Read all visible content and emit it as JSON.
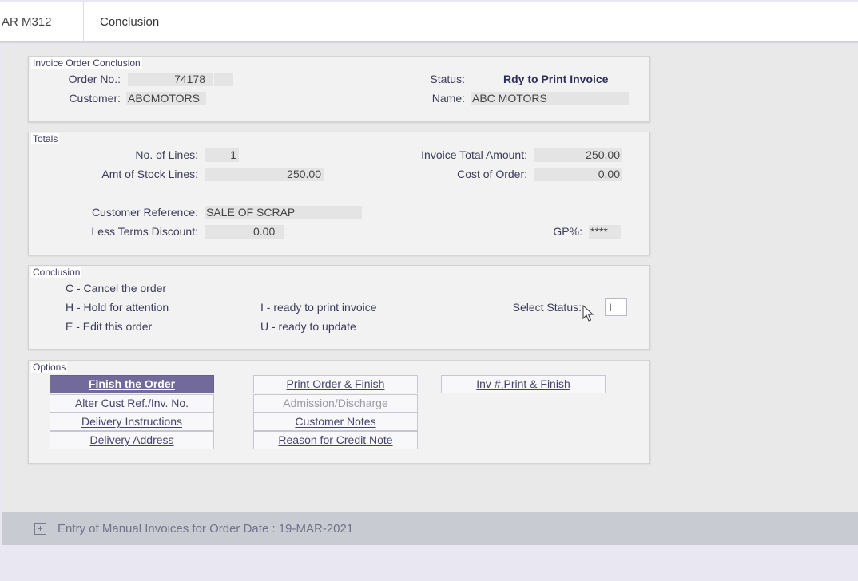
{
  "header": {
    "code": "AR M312",
    "title": "Conclusion"
  },
  "invoice_panel": {
    "legend": "Invoice Order Conclusion",
    "order_no_label": "Order No.:",
    "order_no": "74178",
    "order_suffix": "",
    "customer_label": "Customer:",
    "customer": "ABCMOTORS",
    "status_label": "Status:",
    "status": "Rdy to Print Invoice",
    "name_label": "Name:",
    "name": "ABC MOTORS"
  },
  "totals_panel": {
    "legend": "Totals",
    "lines_label": "No. of Lines:",
    "lines": "1",
    "stock_label": "Amt of Stock Lines:",
    "stock": "250.00",
    "invoice_total_label": "Invoice Total Amount:",
    "invoice_total": "250.00",
    "cost_label": "Cost of Order:",
    "cost": "0.00",
    "cust_ref_label": "Customer Reference:",
    "cust_ref": "SALE OF SCRAP",
    "terms_label": "Less Terms Discount:",
    "terms": "0.00",
    "gp_label": "GP%:",
    "gp": "****"
  },
  "conclusion_panel": {
    "legend": "Conclusion",
    "opt_c": "C  - Cancel the order",
    "opt_h": "H  - Hold for attention",
    "opt_e": "E  - Edit this order",
    "opt_i": "I  - ready to print invoice",
    "opt_u": "U  - ready to update",
    "select_label": "Select Status:",
    "select_value": "I"
  },
  "options_panel": {
    "legend": "Options",
    "finish": {
      "u": "F",
      "rest": "inish the Order"
    },
    "alter": {
      "u": "A",
      "rest": "lter Cust Ref./Inv. No."
    },
    "delivery_instructions": {
      "u": "D",
      "rest": "elivery Instructions"
    },
    "delivery_address": {
      "u": "D",
      "rest": "elivery Address"
    },
    "print_finish": {
      "u": "P",
      "rest": "rint Order & Finish"
    },
    "admission": {
      "u": "A",
      "rest": "dmission/Discharge"
    },
    "customer_notes": {
      "u": "C",
      "rest": "ustomer Notes"
    },
    "reason_credit": {
      "u": "R",
      "rest": "eason for Credit Note"
    },
    "inv_print_finish": {
      "u": "I",
      "rest": "nv #,Print & Finish"
    }
  },
  "footer": {
    "text": "Entry of Manual Invoices for Order Date : 19-MAR-2021"
  },
  "icons": {
    "expand": "plus-square-icon",
    "cursor": "mouse-pointer-icon"
  },
  "colors": {
    "primary_button": "#716a9a",
    "panel_bg": "#f2f2f2",
    "footer_bg": "#c9cbd3"
  }
}
